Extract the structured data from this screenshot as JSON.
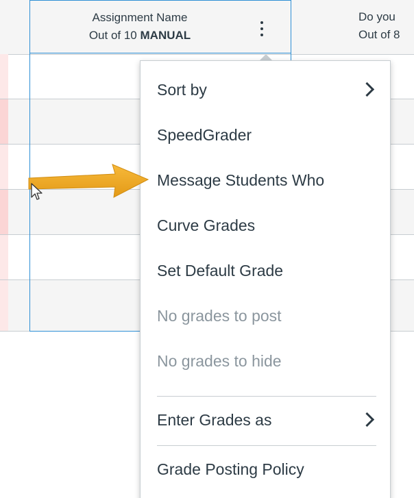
{
  "gradebook": {
    "columns": [
      {
        "title": "Assignment Name",
        "subtitle_prefix": "Out of 10",
        "subtitle_bold": "MANUAL"
      },
      {
        "title": "Do you",
        "subtitle": "Out of 8"
      }
    ]
  },
  "menu": {
    "items": [
      {
        "label": "Sort by",
        "submenu": true,
        "enabled": true
      },
      {
        "label": "SpeedGrader",
        "submenu": false,
        "enabled": true
      },
      {
        "label": "Message Students Who",
        "submenu": false,
        "enabled": true
      },
      {
        "label": "Curve Grades",
        "submenu": false,
        "enabled": true
      },
      {
        "label": "Set Default Grade",
        "submenu": false,
        "enabled": true
      },
      {
        "label": "No grades to post",
        "submenu": false,
        "enabled": false
      },
      {
        "label": "No grades to hide",
        "submenu": false,
        "enabled": false
      },
      {
        "label": "Enter Grades as",
        "submenu": true,
        "enabled": true
      },
      {
        "label": "Grade Posting Policy",
        "submenu": false,
        "enabled": true
      }
    ]
  },
  "colors": {
    "text": "#2d3b45",
    "disabled_text": "#8b969e",
    "focus_border": "#2d8fd5",
    "header_bg": "#f5f5f5",
    "annotation_arrow": "#f0a722",
    "row_flag": "#fbd5d5"
  },
  "icons": {
    "column_options": "kebab-vertical-icon",
    "submenu": "chevron-right-icon",
    "annotation": "arrow-right-annotation",
    "pointer": "mouse-pointer-icon"
  }
}
